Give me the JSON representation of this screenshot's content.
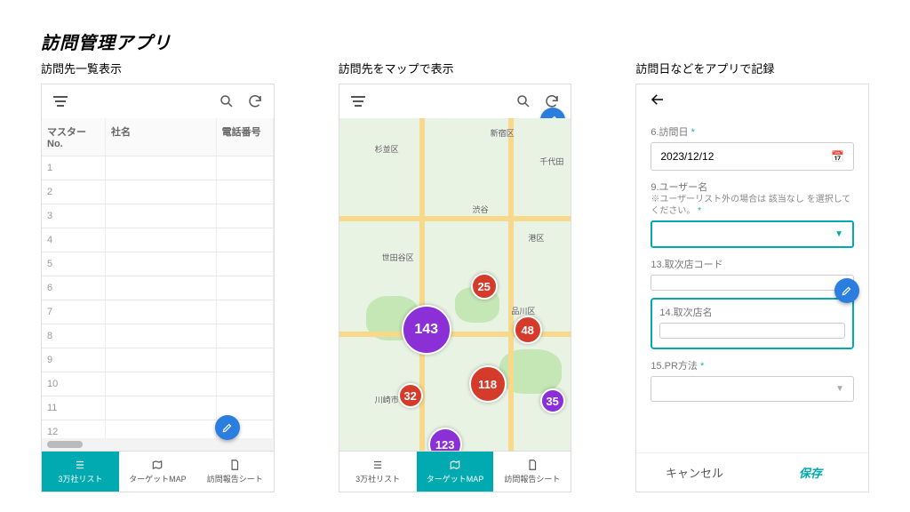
{
  "title": "訪問管理アプリ",
  "captions": {
    "list": "訪問先一覧表示",
    "map": "訪問先をマップで表示",
    "form": "訪問日などをアプリで記録"
  },
  "list": {
    "headers": {
      "no": "マスターNo.",
      "name": "社名",
      "tel": "電話番号"
    },
    "rows": [
      "1",
      "2",
      "3",
      "4",
      "5",
      "6",
      "7",
      "8",
      "9",
      "10",
      "11",
      "12"
    ]
  },
  "tabs": {
    "t1": "3万社リスト",
    "t2": "ターゲットMAP",
    "t3": "訪問報告シート"
  },
  "map": {
    "places": {
      "p1": "杉並区",
      "p2": "新宿区",
      "p3": "千代田",
      "p4": "渋谷",
      "p5": "世田谷区",
      "p6": "品川区",
      "p7": "川崎市",
      "p8": "港区"
    },
    "clusters": {
      "c1": "25",
      "c2": "143",
      "c3": "48",
      "c4": "32",
      "c5": "118",
      "c6": "35",
      "c7": "123"
    }
  },
  "form": {
    "f6_label": "6.訪問日",
    "f6_value": "2023/12/12",
    "f9_label": "9.ユーザー名",
    "f9_note": "※ユーザーリスト外の場合は 該当なし を選択してください。",
    "f13_label": "13.取次店コード",
    "f14_label": "14.取次店名",
    "f15_label": "15.PR方法",
    "cancel": "キャンセル",
    "save": "保存"
  }
}
